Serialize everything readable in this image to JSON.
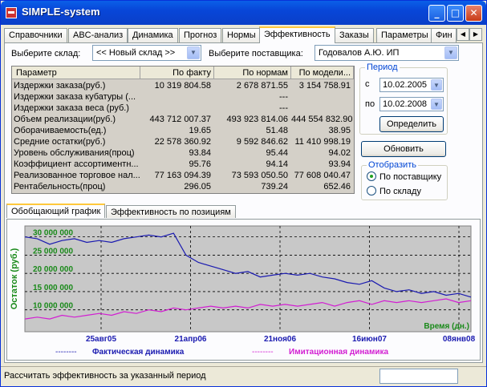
{
  "window": {
    "title": "SIMPLE-system",
    "minimize": "_",
    "maximize": "□",
    "close": "✕"
  },
  "tabs": [
    "Справочники",
    "ABC-анализ",
    "Динамика",
    "Прогноз",
    "Нормы",
    "Эффективность",
    "Заказы",
    "Параметры",
    "Фин"
  ],
  "active_tab": "Эффективность",
  "filters": {
    "warehouse_label": "Выберите склад:",
    "warehouse_value": "<< Новый склад >>",
    "supplier_label": "Выберите поставщика:",
    "supplier_value": "Годовалов А.Ю. ИП"
  },
  "table": {
    "headers": [
      "Параметр",
      "По факту",
      "По нормам",
      "По модели..."
    ],
    "rows": [
      [
        "Издержки заказа(руб.)",
        "10 319 804.58",
        "2 678 871.55",
        "3 154 758.91"
      ],
      [
        "Издержки заказа кубатуры (...",
        "",
        "---",
        ""
      ],
      [
        "Издержки заказа веса (руб.)",
        "",
        "---",
        ""
      ],
      [
        "Объем реализации(руб.)",
        "443 712 007.37",
        "493 923 814.06",
        "444 554 832.90"
      ],
      [
        "Оборачиваемость(ед.)",
        "19.65",
        "51.48",
        "38.95"
      ],
      [
        "Средние остатки(руб.)",
        "22 578 360.92",
        "9 592 846.62",
        "11 410 998.19"
      ],
      [
        "Уровень обслуживания(проц)",
        "93.84",
        "95.44",
        "94.02"
      ],
      [
        "Коэффициент ассортиментн...",
        "95.76",
        "94.14",
        "93.94"
      ],
      [
        "Реализованное торговое нал...",
        "77 163 094.39",
        "73 593 050.50",
        "77 608 040.47"
      ],
      [
        "Рентабельность(проц)",
        "296.05",
        "739.24",
        "652.46"
      ]
    ]
  },
  "period": {
    "title": "Период",
    "from_label": "с",
    "from_value": "10.02.2005",
    "to_label": "по",
    "to_value": "10.02.2008",
    "determine_button": "Определить"
  },
  "refresh_button": "Обновить",
  "display": {
    "title": "Отобразить",
    "by_supplier": "По поставщику",
    "by_warehouse": "По складу",
    "selected": "by_supplier"
  },
  "subtabs": [
    "Обобщающий график",
    "Эффективность по позициям"
  ],
  "active_subtab": "Обобщающий график",
  "chart_data": {
    "type": "line",
    "ylabel": "Остаток (руб.)",
    "xlabel": "Время (дн.)",
    "y_ticks": [
      "30 000 000",
      "25 000 000",
      "20 000 000",
      "15 000 000",
      "10 000 000"
    ],
    "y_tick_values": [
      30000000,
      25000000,
      20000000,
      15000000,
      10000000
    ],
    "x_ticks": [
      "25авг05",
      "21апр06",
      "21ноя06",
      "16июн07",
      "08янв08"
    ],
    "ylim": [
      4000000,
      33000000
    ],
    "grid": true,
    "legend": [
      {
        "dash": "--------",
        "name": "Фактическая динамика",
        "color": "#1a1ab0"
      },
      {
        "dash": "--------",
        "name": "Имитационная динамика",
        "color": "#d21ed2"
      }
    ],
    "series": [
      {
        "name": "Фактическая динамика",
        "color": "#1a1ab0",
        "x": [
          0,
          30,
          60,
          90,
          120,
          150,
          180,
          210,
          240,
          270,
          300,
          330,
          360,
          390,
          420,
          450,
          480,
          510,
          540,
          570,
          600,
          630,
          660,
          690,
          720,
          750,
          780,
          810,
          840,
          870,
          900,
          930,
          960,
          990,
          1020,
          1050,
          1080
        ],
        "values": [
          30000000,
          29500000,
          28000000,
          29000000,
          29500000,
          28500000,
          29000000,
          28500000,
          29500000,
          30000000,
          30500000,
          30000000,
          31000000,
          25000000,
          23000000,
          22000000,
          21000000,
          20000000,
          20500000,
          19000000,
          19500000,
          20000000,
          19500000,
          20000000,
          19000000,
          18500000,
          17500000,
          17000000,
          18000000,
          16000000,
          15000000,
          15500000,
          14500000,
          15000000,
          14000000,
          14500000,
          13500000
        ]
      },
      {
        "name": "Имитационная динамика",
        "color": "#d21ed2",
        "x": [
          0,
          30,
          60,
          90,
          120,
          150,
          180,
          210,
          240,
          270,
          300,
          330,
          360,
          390,
          420,
          450,
          480,
          510,
          540,
          570,
          600,
          630,
          660,
          690,
          720,
          750,
          780,
          810,
          840,
          870,
          900,
          930,
          960,
          990,
          1020,
          1050,
          1080
        ],
        "values": [
          7500000,
          8000000,
          7500000,
          8500000,
          8000000,
          8500000,
          9000000,
          8500000,
          9500000,
          9000000,
          10000000,
          9500000,
          10500000,
          10000000,
          10500000,
          11000000,
          10500000,
          11000000,
          10500000,
          11500000,
          11000000,
          11500000,
          11000000,
          11500000,
          12000000,
          11000000,
          12000000,
          12500000,
          11500000,
          12500000,
          12000000,
          12500000,
          12000000,
          12500000,
          13000000,
          12000000,
          12500000
        ]
      }
    ]
  },
  "status_text": "Рассчитать эффективность за указанный период"
}
